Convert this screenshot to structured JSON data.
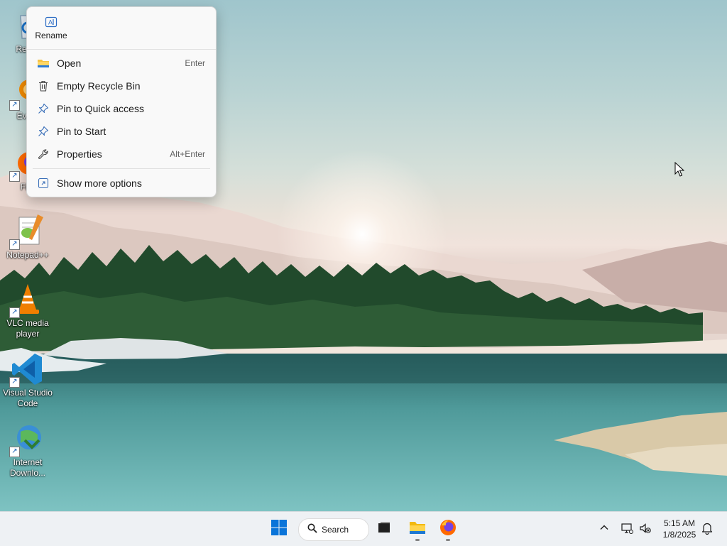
{
  "desktop": {
    "icons": [
      {
        "label": "Recycle Bin",
        "visible_label": "Recyc"
      },
      {
        "label": "Everything",
        "visible_label": "Every"
      },
      {
        "label": "Firefox",
        "visible_label": "Fire"
      },
      {
        "label": "Notepad++"
      },
      {
        "label": "VLC media player"
      },
      {
        "label": "Visual Studio Code"
      },
      {
        "label": "Internet Downlo..."
      }
    ]
  },
  "context_menu": {
    "rename_label": "Rename",
    "items": [
      {
        "label": "Open",
        "shortcut": "Enter",
        "icon": "folder-icon"
      },
      {
        "label": "Empty Recycle Bin",
        "icon": "trash-icon"
      },
      {
        "label": "Pin to Quick access",
        "icon": "pin-icon"
      },
      {
        "label": "Pin to Start",
        "icon": "pin-icon"
      },
      {
        "label": "Properties",
        "shortcut": "Alt+Enter",
        "icon": "wrench-icon"
      }
    ],
    "more_options_label": "Show more options"
  },
  "taskbar": {
    "search_label": "Search",
    "time": "5:15 AM",
    "date": "1/8/2025",
    "accent_color": "#0078d4"
  }
}
